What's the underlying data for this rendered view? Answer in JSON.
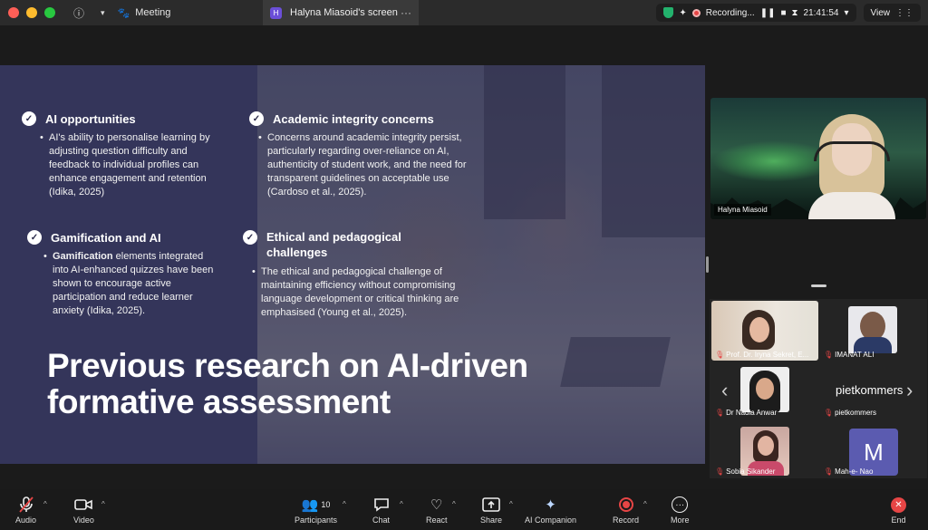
{
  "titlebar": {
    "meeting_label": "Meeting",
    "tab_badge": "H",
    "tab_title": "Halyna Miasoid's screen",
    "tab_menu": "···",
    "recording_label": "Recording...",
    "clock": "21:41:54",
    "view_label": "View"
  },
  "slide": {
    "col1": [
      {
        "head": "AI opportunities",
        "text": "AI's ability to personalise learning by adjusting question difficulty and feedback to individual profiles can enhance engagement and retention (Idika, 2025)"
      },
      {
        "head": "Gamification and AI",
        "text_bold": "Gamification",
        "text": " elements integrated into AI-enhanced quizzes have been shown to encourage active participation and reduce learner anxiety (Idika, 2025)."
      }
    ],
    "col2": [
      {
        "head": "Academic integrity concerns",
        "text": "Concerns around academic integrity persist, particularly regarding over-reliance on AI, authenticity of student work, and the need for transparent guidelines on acceptable use (Cardoso et al., 2025)."
      },
      {
        "head": "Ethical and pedagogical challenges",
        "text": "The ethical and pedagogical challenge of maintaining efficiency without compromising language development or critical thinking are emphasised (Young et al., 2025)."
      }
    ],
    "title": "Previous research on AI-driven formative assessment"
  },
  "speaker": {
    "name": "Halyna Miasoid"
  },
  "gallery": {
    "tiles": [
      {
        "name": "Prof. Dr. Iryna Sekret, E..."
      },
      {
        "name": "IMANAT ALI"
      },
      {
        "name": "Dr Nadia Anwar"
      },
      {
        "name": "pietkommers"
      },
      {
        "name": "Sobia Sikander"
      },
      {
        "name": "Mah-e- Nao"
      }
    ],
    "piet_display": "pietkommers",
    "m_initial": "M",
    "arrow_left": "‹",
    "arrow_right": "›"
  },
  "toolbar": {
    "audio": "Audio",
    "video": "Video",
    "participants": "Participants",
    "participants_count": "10",
    "chat": "Chat",
    "react": "React",
    "share": "Share",
    "ai_companion": "AI Companion",
    "record": "Record",
    "more": "More",
    "end": "End"
  },
  "colors": {
    "slide_bg": "#34355a",
    "record_red": "#e64545",
    "end_red": "#e64545"
  }
}
